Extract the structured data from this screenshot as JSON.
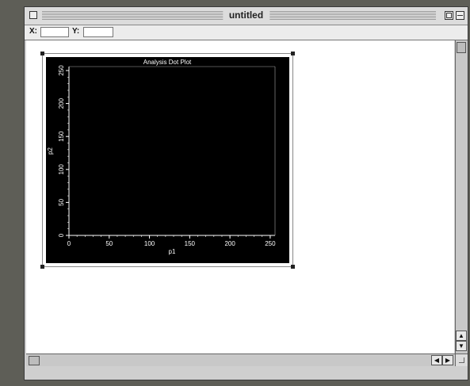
{
  "window": {
    "title": "untitled"
  },
  "coords": {
    "x_label": "X:",
    "x_value": "",
    "y_label": "Y:",
    "y_value": ""
  },
  "chart_data": {
    "type": "scatter",
    "title": "Analysis Dot Plot",
    "xlabel": "p1",
    "ylabel": "p2",
    "xlim": [
      0,
      256
    ],
    "ylim": [
      0,
      256
    ],
    "xticks": [
      "0",
      "50",
      "100",
      "150",
      "200",
      "250"
    ],
    "yticks": [
      "0",
      "50",
      "100",
      "150",
      "200",
      "250"
    ],
    "x": [],
    "y": [],
    "background": "#000000",
    "axis_color": "#ffffff"
  },
  "scroll": {
    "up": "▲",
    "down": "▼",
    "left": "◀",
    "right": "▶"
  }
}
